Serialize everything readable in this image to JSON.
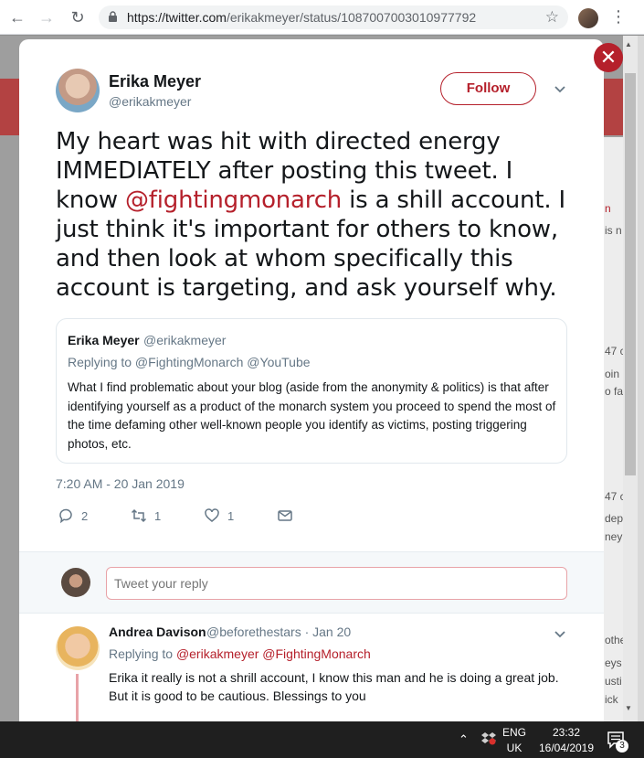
{
  "browser": {
    "url_host": "https://twitter.com",
    "url_path": "/erikakmeyer/status/1087007003010977792"
  },
  "background": {
    "snippets": [
      "n",
      "is n",
      "47 c",
      "oin",
      "o fa",
      "47 c",
      "dep",
      "ney",
      "othe",
      "eys",
      "usti",
      "ick"
    ]
  },
  "tweet": {
    "author_name": "Erika Meyer",
    "author_handle": "@erikakmeyer",
    "follow_label": "Follow",
    "text_before": "My heart was hit with directed energy IMMEDIATELY after posting this tweet. I know ",
    "mention": "@fightingmonarch",
    "text_after": " is a shill account. I just think it's important for others to know, and then look at whom specifically this account is targeting, and ask yourself why.",
    "timestamp": "7:20 AM - 20 Jan 2019",
    "replies": "2",
    "retweets": "1",
    "likes": "1"
  },
  "quote": {
    "name": "Erika Meyer",
    "handle": "@erikakmeyer",
    "replying_to": "Replying to @FightingMonarch @YouTube",
    "text": "What I find problematic about your blog (aside from the anonymity & politics) is that after identifying yourself as a product of the monarch system you proceed to spend the most of the time defaming other well-known people you identify as victims, posting triggering photos, etc."
  },
  "reply_box": {
    "placeholder": "Tweet your reply"
  },
  "reply": {
    "name": "Andrea Davison",
    "meta": "@beforethestars · Jan 20",
    "replying_label": "Replying to ",
    "replying_mentions": "@erikakmeyer @FightingMonarch",
    "text": "Erika it really is not a shrill account,  I know this man and he is doing a great job. But it is good to be cautious. Blessings to you"
  },
  "taskbar": {
    "lang_top": "ENG",
    "lang_bottom": "UK",
    "time": "23:32",
    "date": "16/04/2019",
    "notifications": "3"
  },
  "colors": {
    "accent": "#b5202b",
    "muted": "#657786"
  }
}
